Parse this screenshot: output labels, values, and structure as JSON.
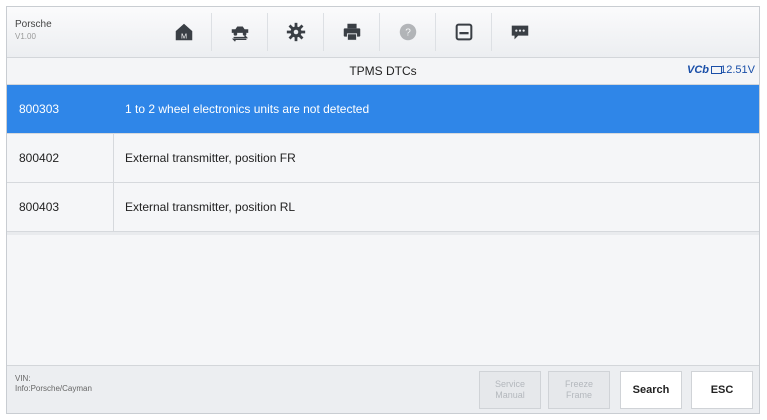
{
  "header": {
    "brand": "Porsche",
    "version": "V1.00",
    "toolbar": [
      {
        "icon": "home-icon",
        "enabled": true
      },
      {
        "icon": "vehicle-swap-icon",
        "enabled": true
      },
      {
        "icon": "gear-icon",
        "enabled": true
      },
      {
        "icon": "printer-icon",
        "enabled": true
      },
      {
        "icon": "help-icon",
        "enabled": false
      },
      {
        "icon": "save-icon",
        "enabled": true
      },
      {
        "icon": "chat-icon",
        "enabled": true
      }
    ]
  },
  "titlebar": {
    "title": "TPMS DTCs",
    "vci_label": "VCb",
    "voltage": "12.51V"
  },
  "dtcs": [
    {
      "code": "800303",
      "description": "1 to 2 wheel electronics units are not detected",
      "selected": true
    },
    {
      "code": "800402",
      "description": "External transmitter, position FR",
      "selected": false
    },
    {
      "code": "800403",
      "description": "External transmitter, position RL",
      "selected": false
    }
  ],
  "footer": {
    "vin_label": "VIN:",
    "vehicle_info": "Info:Porsche/Cayman",
    "buttons": {
      "service_manual": "Service\nManual",
      "freeze_frame": "Freeze\nFrame",
      "search": "Search",
      "esc": "ESC"
    }
  },
  "colors": {
    "selected_row": "#2f86e8",
    "accent": "#1a4fa8"
  }
}
